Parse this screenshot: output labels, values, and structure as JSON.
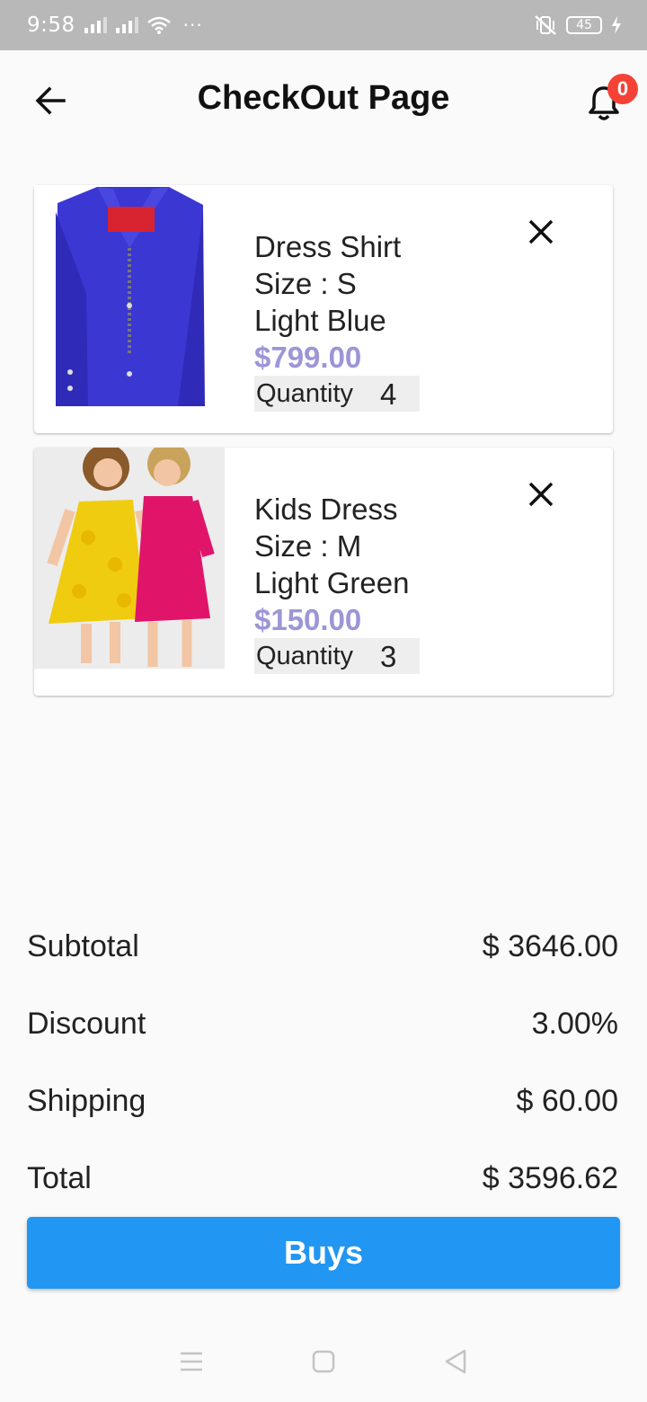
{
  "status_bar": {
    "time": "9:58",
    "dots": "···",
    "battery": "45"
  },
  "app_bar": {
    "title": "CheckOut Page",
    "notification_count": "0"
  },
  "cart_items": [
    {
      "name": "Dress Shirt",
      "size": "Size : S",
      "color": "Light Blue",
      "price": "$799.00",
      "quantity_label": "Quantity",
      "quantity": "4"
    },
    {
      "name": "Kids Dress",
      "size": "Size : M",
      "color": "Light Green",
      "price": "$150.00",
      "quantity_label": "Quantity",
      "quantity": "3"
    }
  ],
  "summary": {
    "subtotal_label": "Subtotal",
    "subtotal_value": "$ 3646.00",
    "discount_label": "Discount",
    "discount_value": "3.00%",
    "shipping_label": "Shipping",
    "shipping_value": "$ 60.00",
    "total_label": "Total",
    "total_value": "$ 3596.62"
  },
  "buy_button_label": "Buys",
  "colors": {
    "accent": "#2196f3",
    "price": "#9b96d6",
    "badge": "#f44336"
  }
}
